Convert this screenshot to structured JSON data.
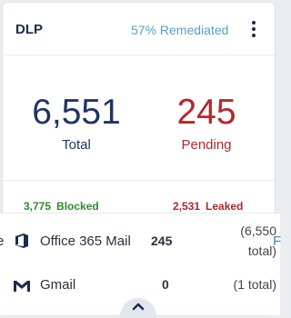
{
  "header": {
    "title": "DLP",
    "remediated": "57% Remediated",
    "menu_icon": "kebab-menu-icon"
  },
  "metrics": {
    "total_value": "6,551",
    "total_label": "Total",
    "pending_value": "245",
    "pending_label": "Pending"
  },
  "summary": {
    "blocked_count": "3,775",
    "blocked_label": "Blocked",
    "leaked_count": "2,531",
    "leaked_label": "Leaked"
  },
  "rows": [
    {
      "icon": "office-365-icon",
      "name": "Office 365 Mail",
      "count": "245",
      "total_line1": "(6,550",
      "total_line2": "total)"
    },
    {
      "icon": "gmail-icon",
      "name": "Gmail",
      "count": "0",
      "total_line1": "(1 total)"
    }
  ],
  "edge": {
    "left_text": "e",
    "right_text": "F"
  },
  "colors": {
    "navy": "#1f3563",
    "red": "#b5262b",
    "green": "#2e8b2e",
    "link_blue": "#5aa0c8"
  }
}
